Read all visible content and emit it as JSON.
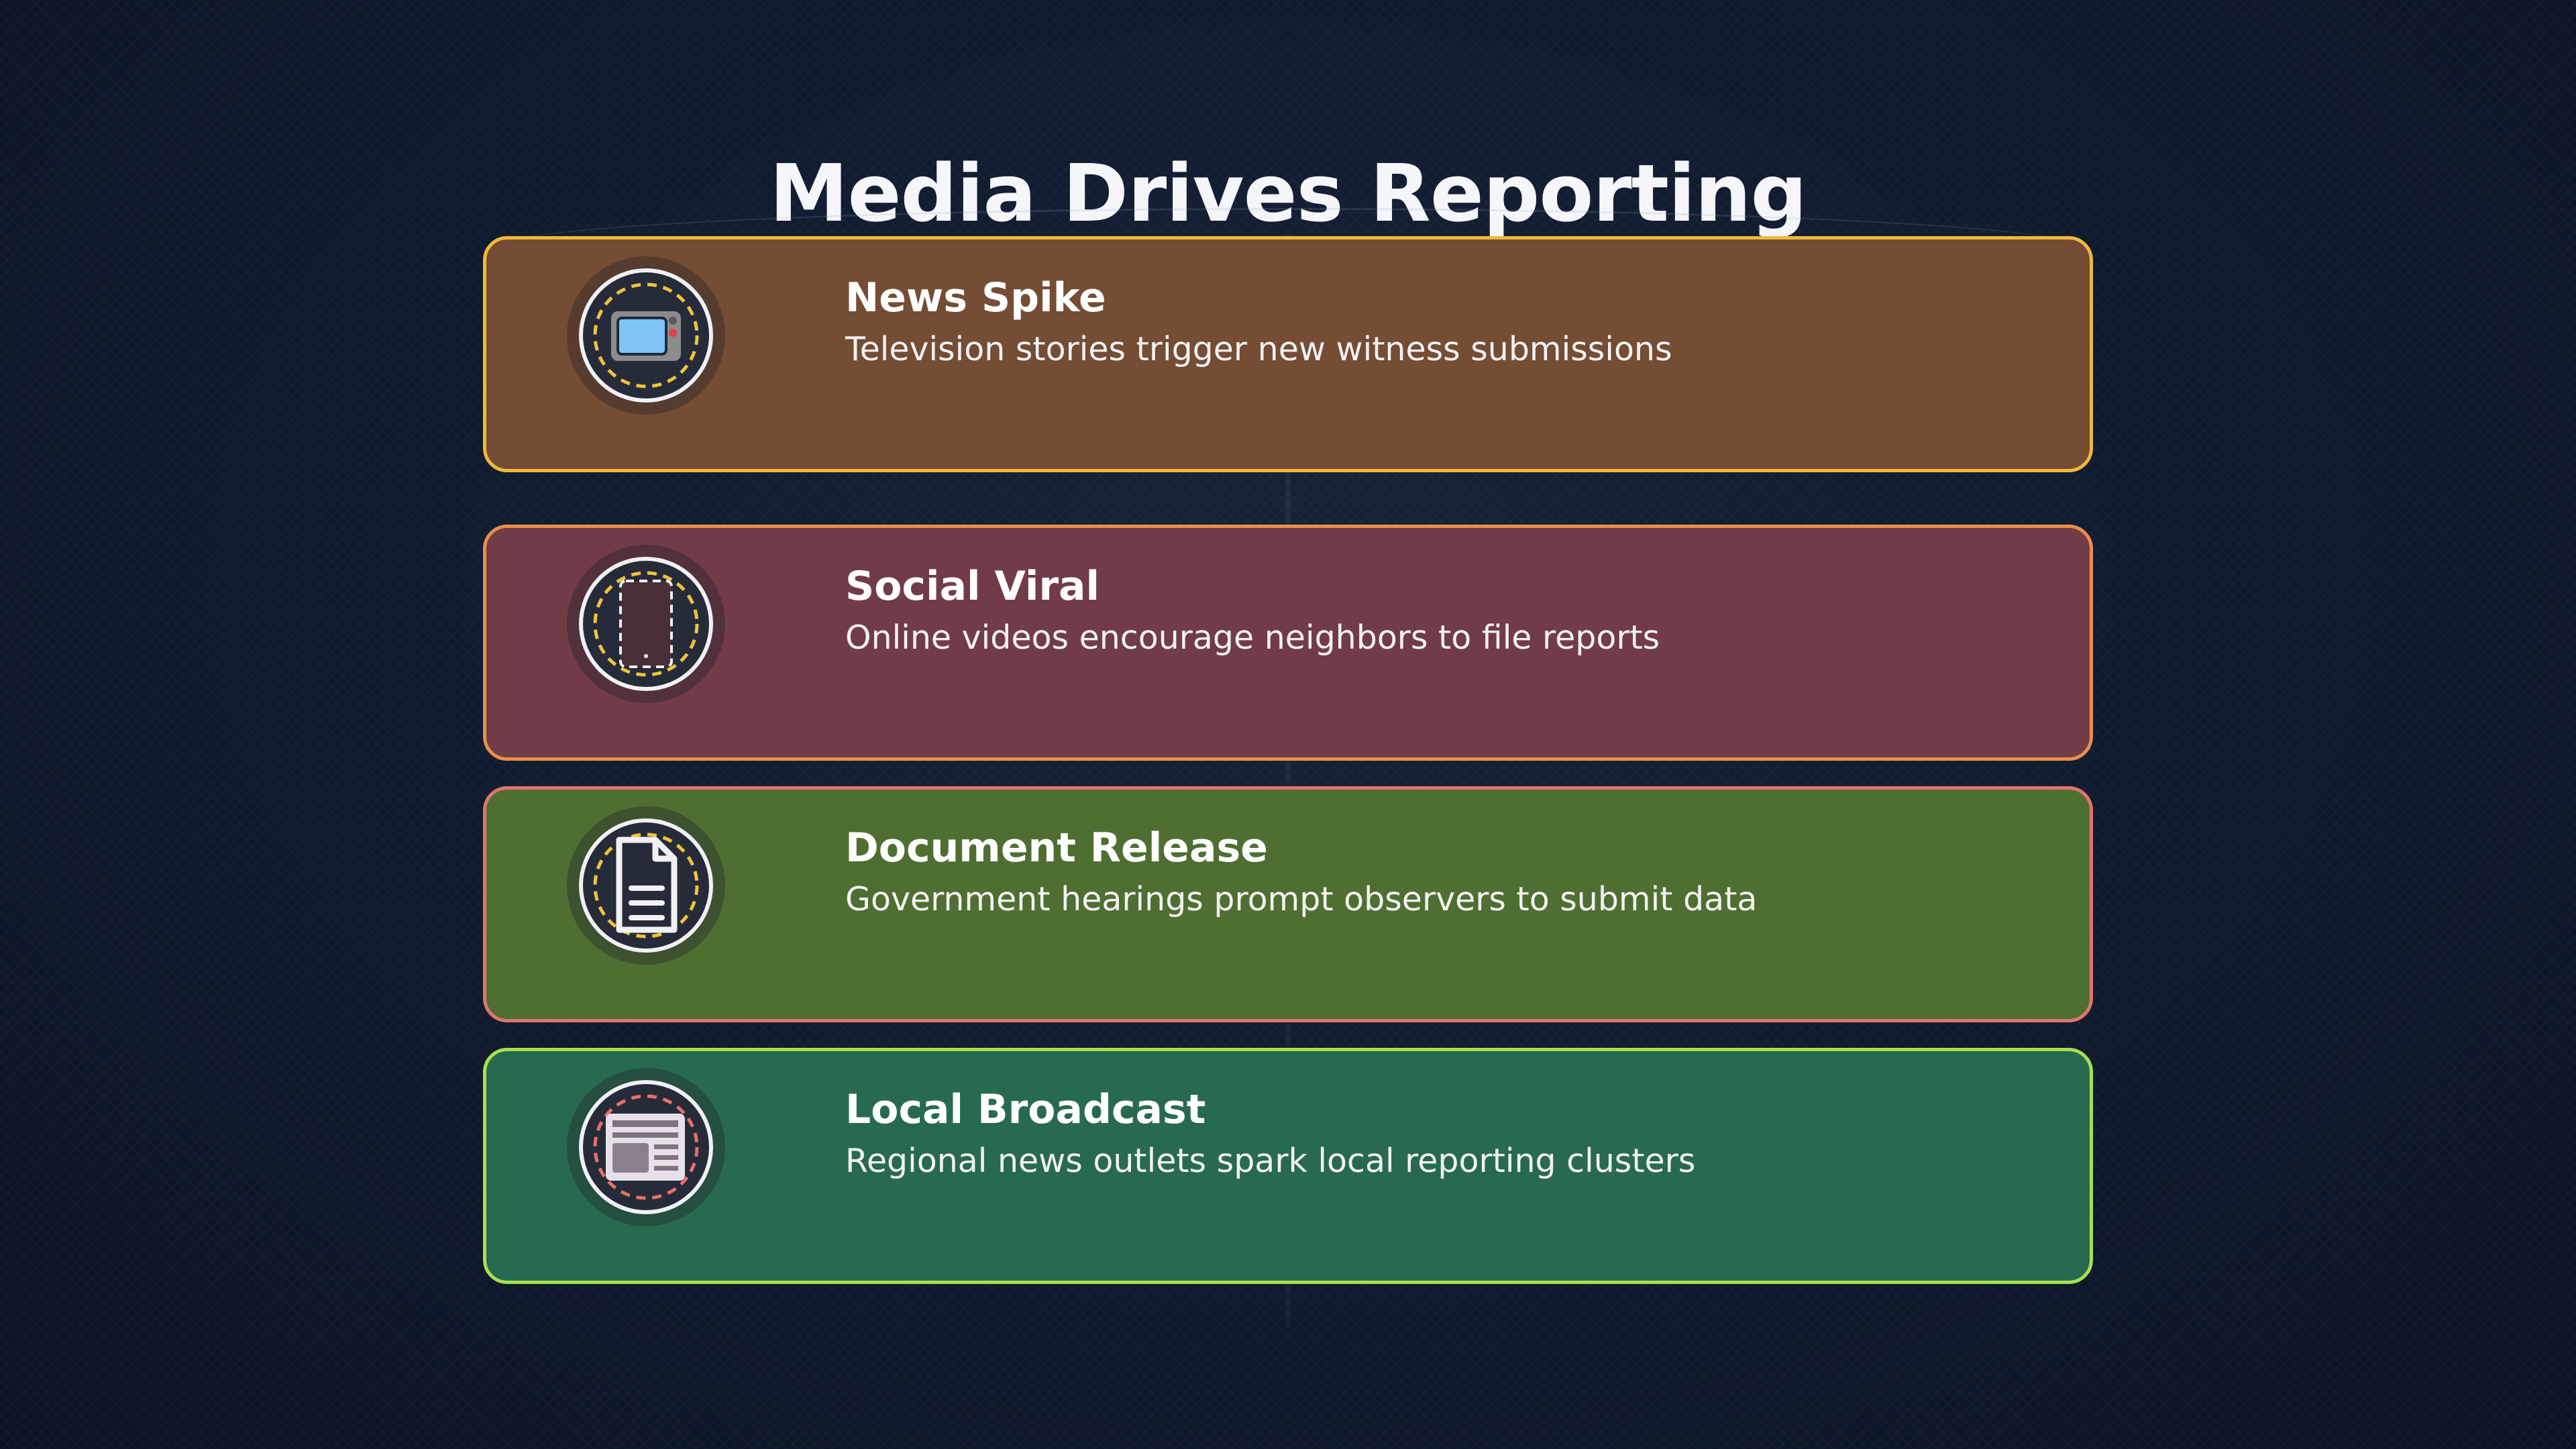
{
  "title": "Media Drives Reporting",
  "items": [
    {
      "title": "News Spike",
      "description": "Television stories trigger new witness submissions",
      "icon": "television-icon",
      "fill": "#744d34",
      "border": "#f0b93a"
    },
    {
      "title": "Social Viral",
      "description": "Online videos encourage neighbors to file reports",
      "icon": "smartphone-icon",
      "fill": "#713c48",
      "border": "#e98f4a"
    },
    {
      "title": "Document Release",
      "description": "Government hearings prompt observers to submit data",
      "icon": "document-icon",
      "fill": "#4f6f32",
      "border": "#e2736d"
    },
    {
      "title": "Local Broadcast",
      "description": "Regional news outlets spark local reporting clusters",
      "icon": "newspaper-icon",
      "fill": "#286a4f",
      "border": "#a8e04e"
    }
  ]
}
